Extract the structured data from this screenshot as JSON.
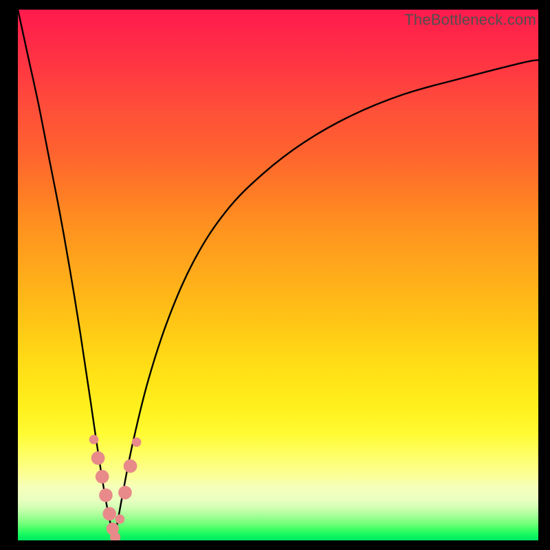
{
  "watermark": "TheBottleneck.com",
  "chart_data": {
    "type": "line",
    "title": "",
    "xlabel": "",
    "ylabel": "",
    "xlim": [
      0,
      100
    ],
    "ylim": [
      0,
      100
    ],
    "grid": false,
    "series": [
      {
        "name": "left-branch",
        "x": [
          0,
          2,
          4,
          6,
          8,
          10,
          12,
          14,
          15.5,
          17,
          18.5
        ],
        "y": [
          100,
          91,
          82,
          72,
          62,
          51,
          39,
          26,
          16,
          7,
          0
        ]
      },
      {
        "name": "right-branch",
        "x": [
          18.5,
          20,
          22,
          25,
          29,
          34,
          40,
          47,
          55,
          64,
          74,
          85,
          97,
          100
        ],
        "y": [
          0,
          8,
          18,
          30,
          42,
          53,
          62,
          69,
          75,
          80,
          84,
          87,
          90,
          90.5
        ]
      }
    ],
    "markers": [
      {
        "name": "m1",
        "x": 14.6,
        "y": 19.0,
        "r": 0.9
      },
      {
        "name": "m2",
        "x": 15.4,
        "y": 15.5,
        "r": 1.3
      },
      {
        "name": "m3",
        "x": 16.2,
        "y": 12.0,
        "r": 1.3
      },
      {
        "name": "m4",
        "x": 16.9,
        "y": 8.5,
        "r": 1.3
      },
      {
        "name": "m5",
        "x": 17.6,
        "y": 5.0,
        "r": 1.3
      },
      {
        "name": "m6",
        "x": 18.2,
        "y": 2.2,
        "r": 1.2
      },
      {
        "name": "m7",
        "x": 18.7,
        "y": 0.6,
        "r": 1.0
      },
      {
        "name": "m8",
        "x": 19.6,
        "y": 4.0,
        "r": 0.9
      },
      {
        "name": "m9",
        "x": 20.6,
        "y": 9.0,
        "r": 1.3
      },
      {
        "name": "m10",
        "x": 21.6,
        "y": 14.0,
        "r": 1.3
      },
      {
        "name": "m11",
        "x": 22.8,
        "y": 18.5,
        "r": 0.9
      }
    ],
    "colors": {
      "curve": "#000000",
      "markers": "#e88a8a",
      "gradient_top": "#ff1a4d",
      "gradient_bottom": "#00e861"
    }
  }
}
